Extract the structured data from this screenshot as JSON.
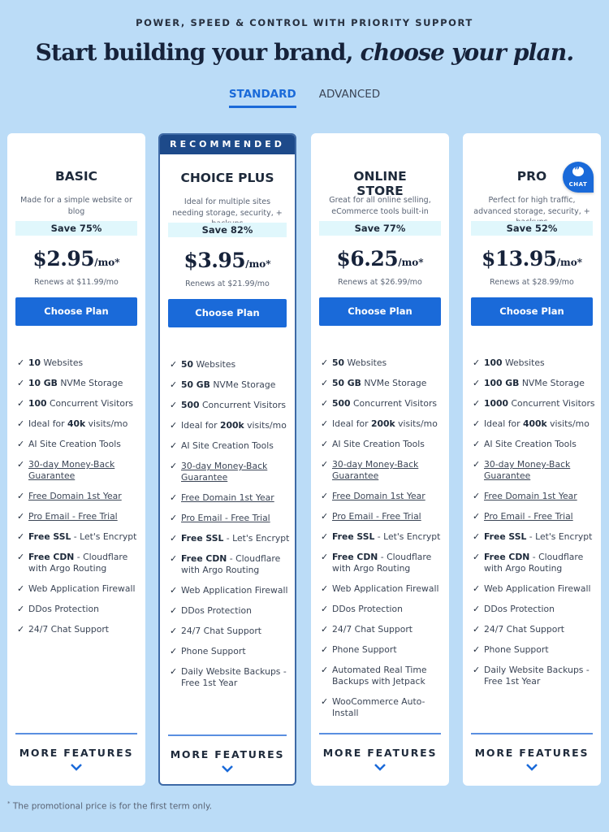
{
  "header": {
    "eyebrow": "POWER, SPEED & CONTROL WITH PRIORITY SUPPORT",
    "headline_regular": "Start building your brand, ",
    "headline_italic": "choose your plan."
  },
  "tabs": [
    {
      "label": "STANDARD",
      "active": true
    },
    {
      "label": "ADVANCED",
      "active": false
    }
  ],
  "colors": {
    "background": "#bbdcf7",
    "accent": "#1a6ad9",
    "recommended_banner": "#1d4a8a",
    "save_badge_bg": "#e0f7fc"
  },
  "plans": [
    {
      "name": "BASIC",
      "description": "Made for a simple website or blog",
      "save": "Save 75%",
      "price": "$2.95",
      "per": "/mo*",
      "renews": "Renews at $11.99/mo",
      "button": "Choose Plan",
      "features": [
        {
          "bold": "10",
          "text": " Websites"
        },
        {
          "bold": "10 GB",
          "text": " NVMe Storage"
        },
        {
          "bold": "100",
          "text": " Concurrent Visitors"
        },
        {
          "pre": "Ideal for ",
          "bold": "40k",
          "text": " visits/mo"
        },
        {
          "text": "AI Site Creation Tools"
        },
        {
          "link": "30-day Money-Back Guarantee"
        },
        {
          "link": "Free Domain 1st Year"
        },
        {
          "link": "Pro Email - Free Trial"
        },
        {
          "bold": "Free SSL",
          "text": " - Let's Encrypt"
        },
        {
          "bold": "Free CDN",
          "text": " - Cloudflare with Argo Routing"
        },
        {
          "text": "Web Application Firewall"
        },
        {
          "text": "DDos Protection"
        },
        {
          "text": "24/7 Chat Support"
        }
      ],
      "more": "MORE FEATURES"
    },
    {
      "name": "CHOICE PLUS",
      "recommended": "RECOMMENDED",
      "description": "Ideal for multiple sites needing storage, security, + backups",
      "save": "Save 82%",
      "price": "$3.95",
      "per": "/mo*",
      "renews": "Renews at $21.99/mo",
      "button": "Choose Plan",
      "features": [
        {
          "bold": "50",
          "text": " Websites"
        },
        {
          "bold": "50 GB",
          "text": " NVMe Storage"
        },
        {
          "bold": "500",
          "text": " Concurrent Visitors"
        },
        {
          "pre": "Ideal for ",
          "bold": "200k",
          "text": " visits/mo"
        },
        {
          "text": "AI Site Creation Tools"
        },
        {
          "link": "30-day Money-Back Guarantee"
        },
        {
          "link": "Free Domain 1st Year"
        },
        {
          "link": "Pro Email - Free Trial"
        },
        {
          "bold": "Free SSL",
          "text": " - Let's Encrypt"
        },
        {
          "bold": "Free CDN",
          "text": " - Cloudflare with Argo Routing"
        },
        {
          "text": "Web Application Firewall"
        },
        {
          "text": "DDos Protection"
        },
        {
          "text": "24/7 Chat Support"
        },
        {
          "text": "Phone Support"
        },
        {
          "text": "Daily Website Backups - Free 1st Year"
        }
      ],
      "more": "MORE FEATURES"
    },
    {
      "name": "ONLINE STORE",
      "description": "Great for all online selling, eCommerce tools built-in",
      "save": "Save 77%",
      "price": "$6.25",
      "per": "/mo*",
      "renews": "Renews at $26.99/mo",
      "button": "Choose Plan",
      "features": [
        {
          "bold": "50",
          "text": " Websites"
        },
        {
          "bold": "50 GB",
          "text": " NVMe Storage"
        },
        {
          "bold": "500",
          "text": " Concurrent Visitors"
        },
        {
          "pre": "Ideal for ",
          "bold": "200k",
          "text": " visits/mo"
        },
        {
          "text": "AI Site Creation Tools"
        },
        {
          "link": "30-day Money-Back Guarantee"
        },
        {
          "link": "Free Domain 1st Year"
        },
        {
          "link": "Pro Email - Free Trial"
        },
        {
          "bold": "Free SSL",
          "text": " - Let's Encrypt"
        },
        {
          "bold": "Free CDN",
          "text": " - Cloudflare with Argo Routing"
        },
        {
          "text": "Web Application Firewall"
        },
        {
          "text": "DDos Protection"
        },
        {
          "text": "24/7 Chat Support"
        },
        {
          "text": "Phone Support"
        },
        {
          "text": "Automated Real Time Backups with Jetpack"
        },
        {
          "text": "WooCommerce Auto-Install"
        }
      ],
      "more": "MORE FEATURES"
    },
    {
      "name": "PRO",
      "description": "Perfect for high traffic, advanced storage, security, + backups",
      "save": "Save 52%",
      "price": "$13.95",
      "per": "/mo*",
      "renews": "Renews at $28.99/mo",
      "button": "Choose Plan",
      "features": [
        {
          "bold": "100",
          "text": " Websites"
        },
        {
          "bold": "100 GB",
          "text": " NVMe Storage"
        },
        {
          "bold": "1000",
          "text": " Concurrent Visitors"
        },
        {
          "pre": "Ideal for ",
          "bold": "400k",
          "text": " visits/mo"
        },
        {
          "text": "AI Site Creation Tools"
        },
        {
          "link": "30-day Money-Back Guarantee"
        },
        {
          "link": "Free Domain 1st Year"
        },
        {
          "link": "Pro Email - Free Trial"
        },
        {
          "bold": "Free SSL",
          "text": " - Let's Encrypt"
        },
        {
          "bold": "Free CDN",
          "text": " - Cloudflare with Argo Routing"
        },
        {
          "text": "Web Application Firewall"
        },
        {
          "text": "DDos Protection"
        },
        {
          "text": "24/7 Chat Support"
        },
        {
          "text": "Phone Support"
        },
        {
          "text": "Daily Website Backups - Free 1st Year"
        }
      ],
      "more": "MORE FEATURES"
    }
  ],
  "chat": {
    "label": "CHAT",
    "icon": "chat-quote-icon"
  },
  "footnote": {
    "mark": "*",
    "text": " The promotional price is for the first term only."
  }
}
